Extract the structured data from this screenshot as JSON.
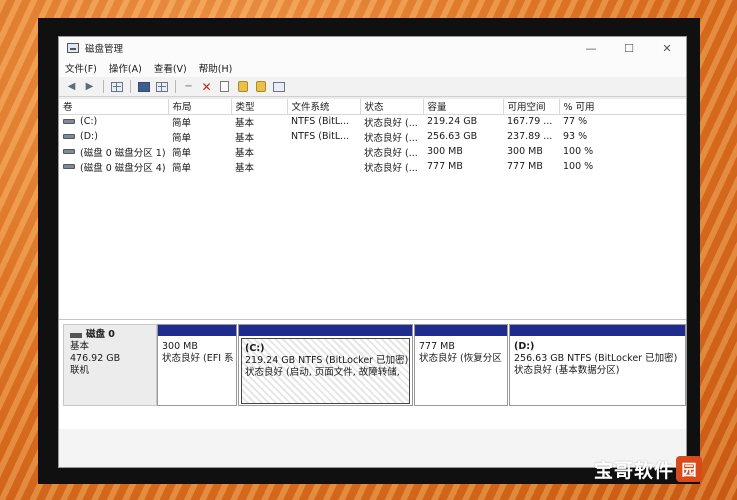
{
  "window": {
    "title": "磁盘管理",
    "minimize": "—",
    "maximize": "☐",
    "close": "✕"
  },
  "menu": [
    "文件(F)",
    "操作(A)",
    "查看(V)",
    "帮助(H)"
  ],
  "toolbar_icons": [
    "back-icon",
    "forward-icon",
    "console-tree-icon",
    "help-icon",
    "properties-icon",
    "connect-icon",
    "delete-icon",
    "document-icon",
    "key-icon",
    "shield-key-icon",
    "refresh-icon"
  ],
  "volume_list": {
    "columns": [
      "卷",
      "布局",
      "类型",
      "文件系统",
      "状态",
      "容量",
      "可用空间",
      "% 可用"
    ],
    "rows": [
      [
        "(C:)",
        "简单",
        "基本",
        "NTFS (BitL...",
        "状态良好 (...",
        "219.24 GB",
        "167.79 ...",
        "77 %"
      ],
      [
        "(D:)",
        "简单",
        "基本",
        "NTFS (BitL...",
        "状态良好 (...",
        "256.63 GB",
        "237.89 ...",
        "93 %"
      ],
      [
        "(磁盘 0 磁盘分区 1)",
        "简单",
        "基本",
        "",
        "状态良好 (...",
        "300 MB",
        "300 MB",
        "100 %"
      ],
      [
        "(磁盘 0 磁盘分区 4)",
        "简单",
        "基本",
        "",
        "状态良好 (...",
        "777 MB",
        "777 MB",
        "100 %"
      ]
    ]
  },
  "disk": {
    "name": "磁盘 0",
    "type": "基本",
    "size": "476.92 GB",
    "status": "联机"
  },
  "partitions": [
    {
      "title": "",
      "line1": "300 MB",
      "line2": "状态良好 (EFI 系"
    },
    {
      "title": "(C:)",
      "line1": "219.24 GB NTFS (BitLocker 已加密)",
      "line2": "状态良好 (启动, 页面文件, 故障转储,"
    },
    {
      "title": "",
      "line1": "777 MB",
      "line2": "状态良好 (恢复分区"
    },
    {
      "title": "(D:)",
      "line1": "256.63 GB NTFS (BitLocker 已加密)",
      "line2": "状态良好 (基本数据分区)"
    }
  ],
  "watermark": {
    "text": "宝哥软件",
    "badge": "园"
  },
  "colors": {
    "partition_cap": "#1f2b8f",
    "background_orange": "#e07a2a"
  }
}
